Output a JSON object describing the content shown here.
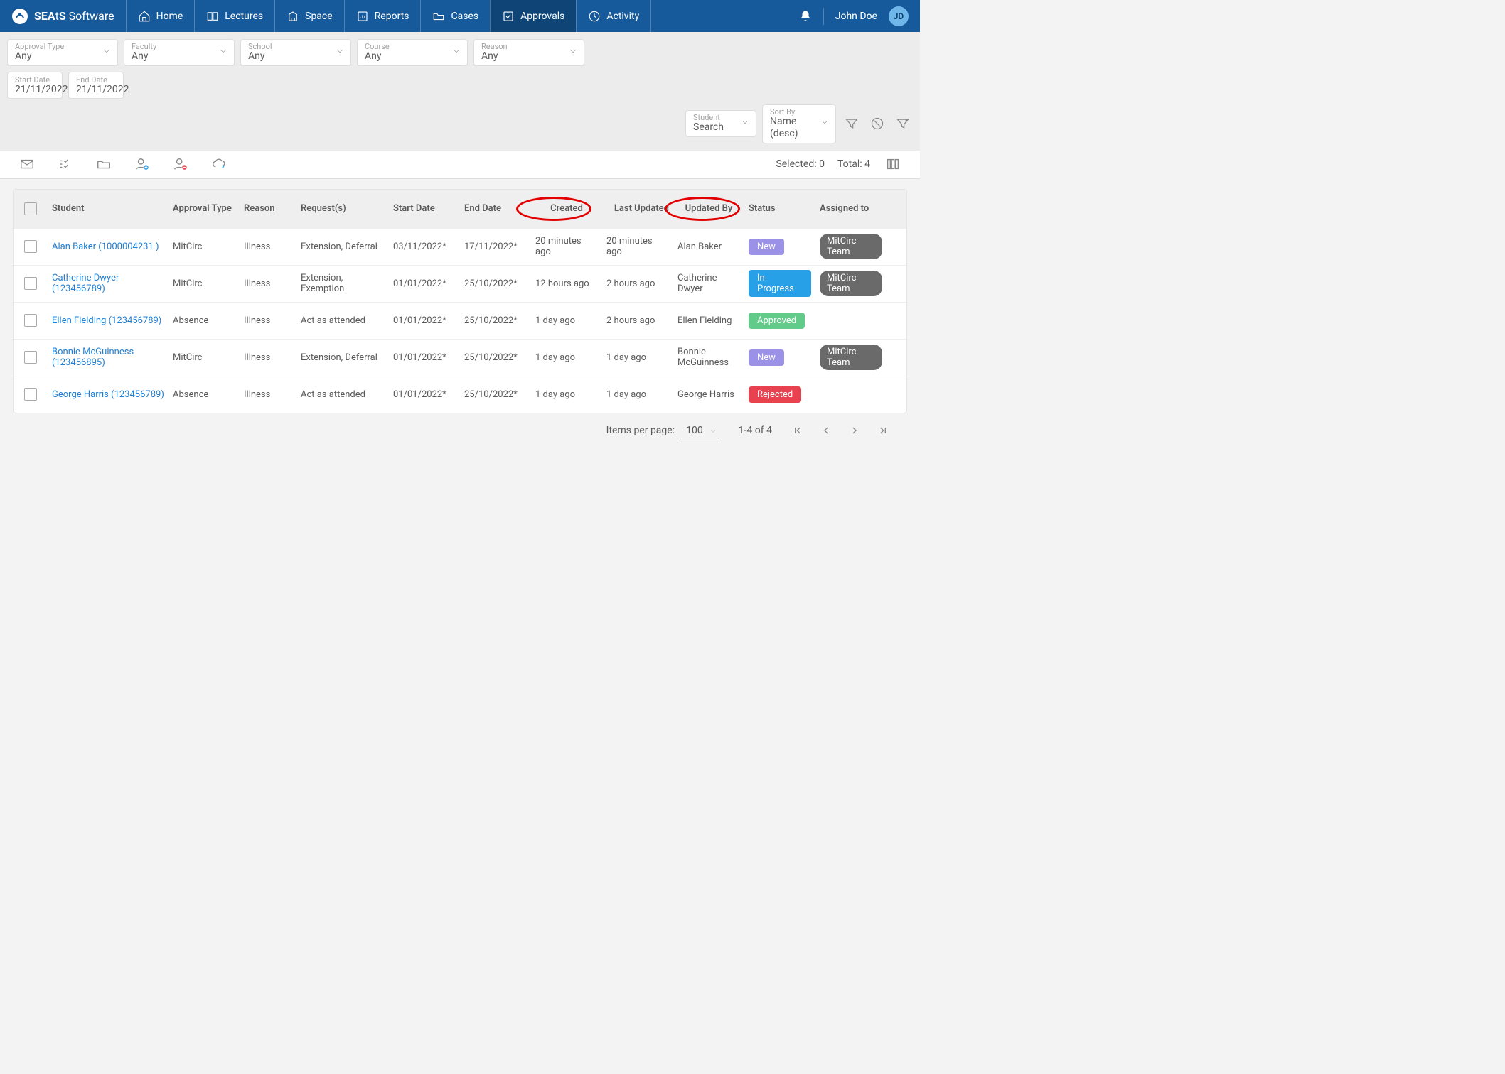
{
  "brand": {
    "name_bold": "SEA",
    "name_mid": "t",
    "name_bold2": "S",
    "name_rest": " Software"
  },
  "nav": [
    {
      "label": "Home"
    },
    {
      "label": "Lectures"
    },
    {
      "label": "Space"
    },
    {
      "label": "Reports"
    },
    {
      "label": "Cases"
    },
    {
      "label": "Approvals"
    },
    {
      "label": "Activity"
    }
  ],
  "user": {
    "name": "John Doe",
    "initials": "JD"
  },
  "filters": {
    "approval_type": {
      "label": "Approval Type",
      "value": "Any"
    },
    "faculty": {
      "label": "Faculty",
      "value": "Any"
    },
    "school": {
      "label": "School",
      "value": "Any"
    },
    "course": {
      "label": "Course",
      "value": "Any"
    },
    "reason": {
      "label": "Reason",
      "value": "Any"
    },
    "start_date": {
      "label": "Start Date",
      "value": "21/11/2022"
    },
    "end_date": {
      "label": "End Date",
      "value": "21/11/2022"
    },
    "student": {
      "label": "Student",
      "value": "Search"
    },
    "sort_by": {
      "label": "Sort By",
      "value": "Name (desc)"
    }
  },
  "strip": {
    "selected_label": "Selected:",
    "selected_count": "0",
    "total_label": "Total:",
    "total_count": "4"
  },
  "headers": {
    "student": "Student",
    "approval_type": "Approval Type",
    "reason": "Reason",
    "requests": "Request(s)",
    "start_date": "Start Date",
    "end_date": "End Date",
    "created": "Created",
    "last_updated": "Last Updated",
    "updated_by": "Updated By",
    "status": "Status",
    "assigned_to": "Assigned to"
  },
  "rows": [
    {
      "student": "Alan Baker (1000004231 )",
      "approval_type": "MitCirc",
      "reason": "Illness",
      "requests": "Extension, Deferral",
      "start_date": "03/11/2022*",
      "end_date": "17/11/2022*",
      "created": "20 minutes ago",
      "last_updated": "20 minutes ago",
      "updated_by": "Alan Baker",
      "status": "New",
      "status_class": "new",
      "assigned_to": "MitCirc Team"
    },
    {
      "student": "Catherine Dwyer  (123456789)",
      "approval_type": "MitCirc",
      "reason": "Illness",
      "requests": "Extension, Exemption",
      "start_date": "01/01/2022*",
      "end_date": "25/10/2022*",
      "created": "12 hours ago",
      "last_updated": "2 hours ago",
      "updated_by": "Catherine Dwyer",
      "status": "In Progress",
      "status_class": "inprogress",
      "assigned_to": "MitCirc Team"
    },
    {
      "student": "Ellen Fielding (123456789)",
      "approval_type": "Absence",
      "reason": "Illness",
      "requests": "Act as attended",
      "start_date": "01/01/2022*",
      "end_date": "25/10/2022*",
      "created": "1 day ago",
      "last_updated": "2 hours ago",
      "updated_by": "Ellen Fielding",
      "status": "Approved",
      "status_class": "approved",
      "assigned_to": ""
    },
    {
      "student": "Bonnie McGuinness (123456895)",
      "approval_type": "MitCirc",
      "reason": "Illness",
      "requests": "Extension, Deferral",
      "start_date": "01/01/2022*",
      "end_date": "25/10/2022*",
      "created": "1 day ago",
      "last_updated": "1 day ago",
      "updated_by": "Bonnie McGuinness",
      "status": "New",
      "status_class": "new",
      "assigned_to": "MitCirc Team"
    },
    {
      "student": "George Harris (123456789)",
      "approval_type": "Absence",
      "reason": "Illness",
      "requests": "Act as attended",
      "start_date": "01/01/2022*",
      "end_date": "25/10/2022*",
      "created": "1 day ago",
      "last_updated": "1 day ago",
      "updated_by": "George Harris",
      "status": "Rejected",
      "status_class": "rejected",
      "assigned_to": ""
    }
  ],
  "pagination": {
    "per_page_label": "Items per page:",
    "per_page_value": "100",
    "range": "1-4 of 4"
  }
}
